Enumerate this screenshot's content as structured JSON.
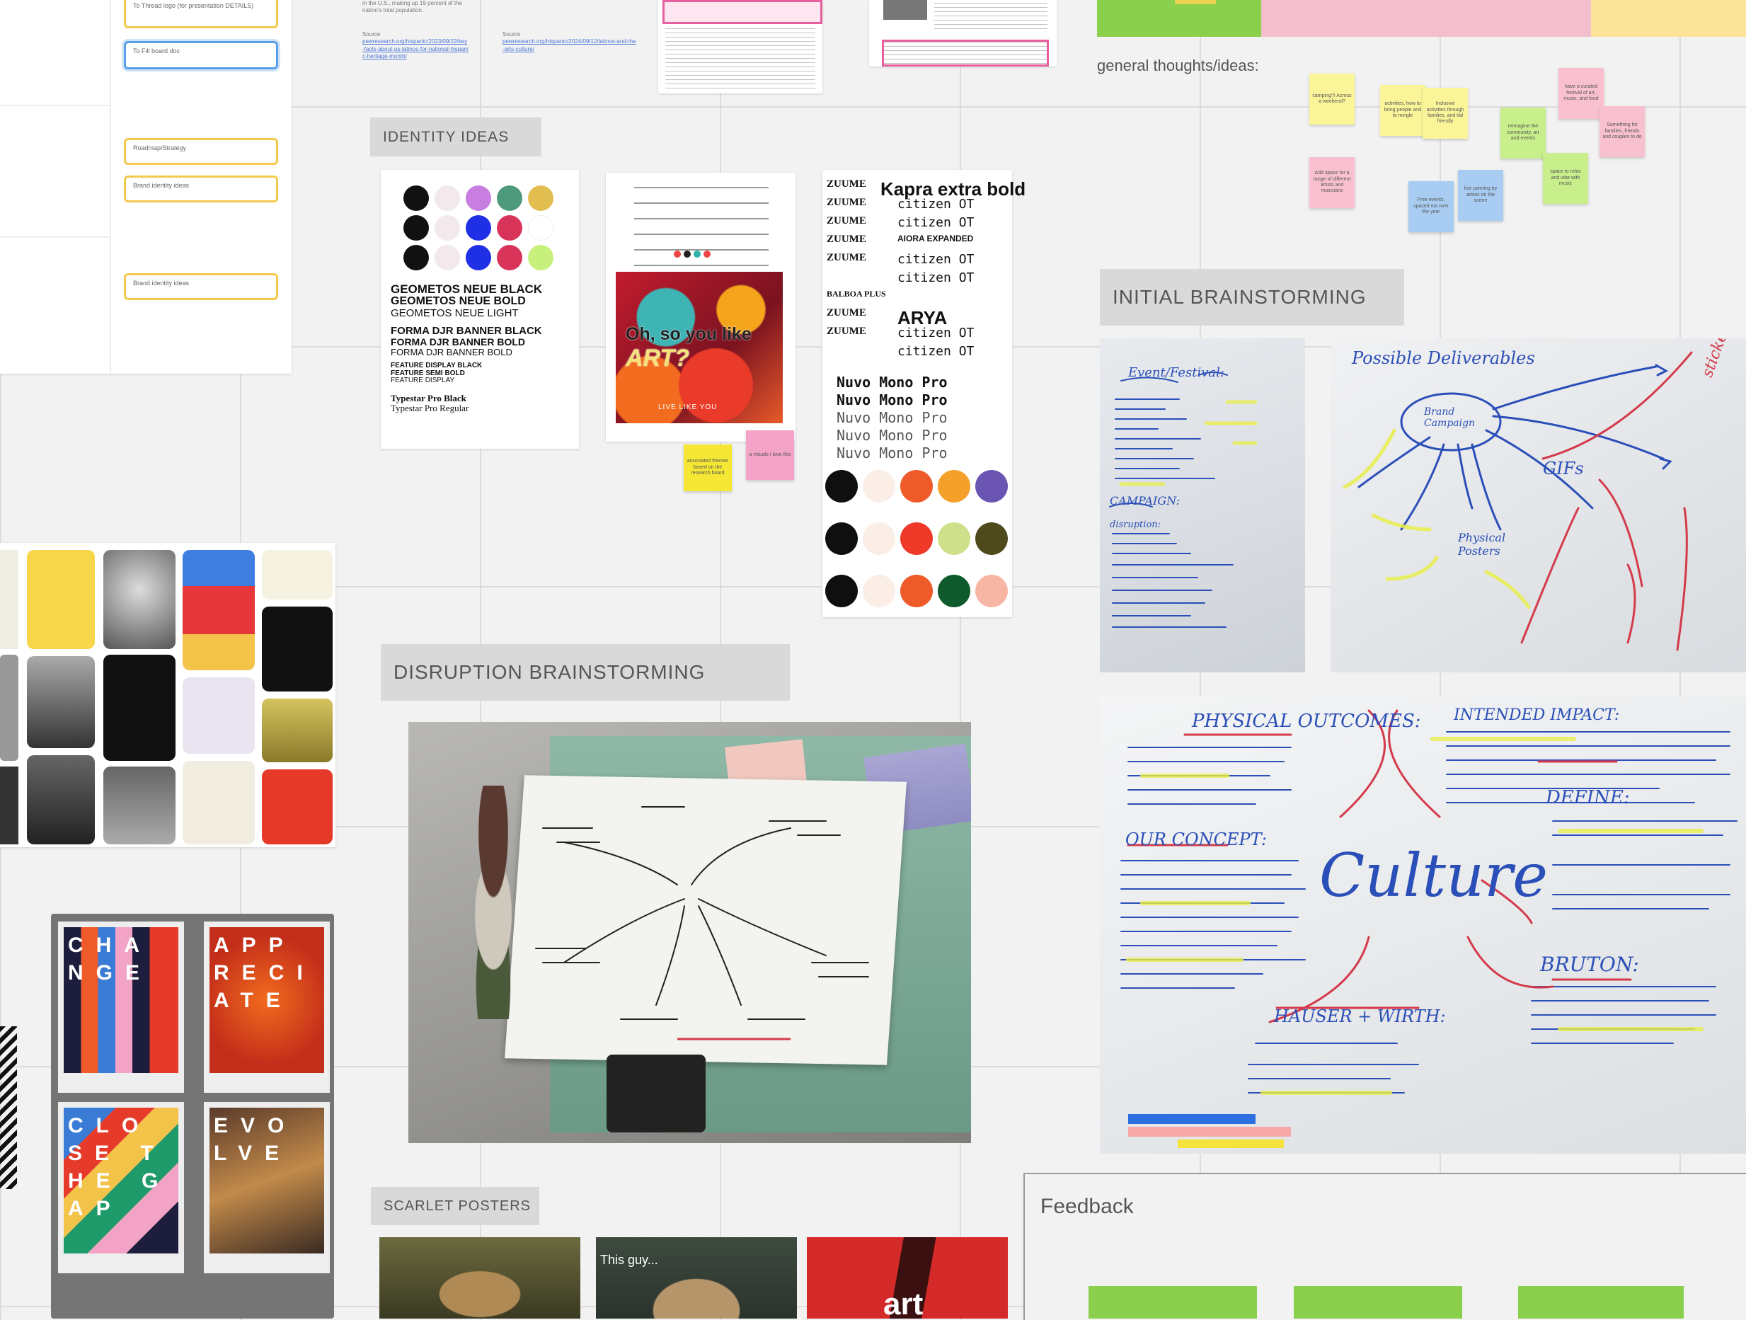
{
  "left_panel": {
    "top_note": "To Thread logo (for presentation DETAILS)",
    "input_active": "To Fill board doc",
    "inputs": [
      "Roadmap/Strategy",
      "Brand identity ideas",
      "Brand identity ideas"
    ]
  },
  "research_text": {
    "line1": "in the U.S., making up 19 percent of the",
    "line2": "nation's total population.",
    "src_label1": "Source",
    "src_label2": "Source",
    "link1": "pewresearch.org/hispanic/2023/09/22/key-facts-about-us-latinos-for-national-hispanic-heritage-month/",
    "link2": "pewresearch.org/hispanic/2024/09/12/latinos-and-the-arts-culture/"
  },
  "headings": {
    "identity_ideas": "IDENTITY IDEAS",
    "initial_brainstorming": "INITIAL BRAINSTORMING",
    "disruption_brainstorming": "DISRUPTION  BRAINSTORMING",
    "scarlet_posters": "SCARLET POSTERS",
    "general_thoughts": "general thoughts/ideas:",
    "feedback": "Feedback"
  },
  "identity_palette_card": {
    "fonts": [
      "GEOMETOS NEUE BLACK",
      "GEOMETOS NEUE BOLD",
      "GEOMETOS NEUE LIGHT",
      "FORMA DJR BANNER BLACK",
      "FORMA DJR BANNER BOLD",
      "FORMA DJR BANNER BOLD",
      "FEATURE DISPLAY BLACK",
      "FEATURE SEMI BOLD",
      "FEATURE DISPLAY",
      "Typestar Pro Black",
      "Typestar Pro Regular"
    ],
    "colors": [
      "#111111",
      "#f3e9ec",
      "#c77ee0",
      "#4f9a7c",
      "#e2bd4f",
      "#111111",
      "#f3e9ec",
      "#1f2fe6",
      "#d8345a",
      "#ffffff",
      "#111111",
      "#f3e9ec",
      "#1f2fe6",
      "#d8345a",
      "#c7f07c"
    ]
  },
  "identity_poster_card": {
    "line1": "Oh, so you like",
    "line2": "ART?",
    "bottom": "LIVE LIKE YOU"
  },
  "identity_stickies": {
    "yellow": "associated themes based on the research board",
    "pink": "a visuals I love this"
  },
  "type_specimen_card": {
    "rows": [
      {
        "left": "ZUUME",
        "right": "Kapra extra bold"
      },
      {
        "left": "ZUUME",
        "right": "citizen OT"
      },
      {
        "left": "ZUUME",
        "right": "citizen OT"
      },
      {
        "left": "ZUUME",
        "right": "AIORA EXPANDED"
      },
      {
        "left": "ZUUME",
        "right": "citizen OT"
      },
      {
        "left": "",
        "right": "citizen OT"
      },
      {
        "left": "BALBOA PLUS",
        "right": ""
      },
      {
        "left": "ZUUME",
        "right": "ARYA"
      },
      {
        "left": "ZUUME",
        "right": "citizen OT"
      },
      {
        "left": "",
        "right": "citizen OT"
      }
    ],
    "mono_rows": [
      "Nuvo Mono Pro",
      "Nuvo Mono Pro",
      "Nuvo Mono Pro",
      "Nuvo Mono Pro",
      "Nuvo Mono Pro"
    ],
    "colors": [
      "#0f0f0f",
      "#fbeee6",
      "#ef5a2a",
      "#f5a02a",
      "#6a55b3",
      "#0f0f0f",
      "#fbeee6",
      "#ef3a2a",
      "#cfe08a",
      "#4f4a1c",
      "#0f0f0f",
      "#fbeee6",
      "#ef5a2a",
      "#0f5a2c",
      "#f7b6a3"
    ]
  },
  "top_right_stickies": [
    {
      "text": "camping?! Across a weekend?",
      "color": "#fbf59a"
    },
    {
      "text": "activities, how to bring people and to mingle",
      "color": "#fbf59a"
    },
    {
      "text": "Inclusive activities through families, and kid friendly",
      "color": "#fbf59a"
    },
    {
      "text": "reimagine the community, art and events",
      "color": "#c8ef8b"
    },
    {
      "text": "have a curated festival of art, music, and food",
      "color": "#f9c1d0"
    },
    {
      "text": "Something for families, friends and couples to do",
      "color": "#f9c1d0"
    },
    {
      "text": "Add space for a range of different artists and musicians",
      "color": "#f9c1d0"
    },
    {
      "text": "Free events, spaced out over the year",
      "color": "#a9cdf2"
    },
    {
      "text": "live painting by artists on the scene",
      "color": "#a9cdf2"
    },
    {
      "text": "space to relax and vibe with music",
      "color": "#c8ef8b"
    }
  ],
  "whiteboards": {
    "small_left": [
      "Event/Festival:",
      "CAMPAIGN:",
      "disruption:"
    ],
    "small_right": [
      "Possible Deliverables",
      "Brand Campaign",
      "Physical Posters",
      "GIFs",
      "stickers"
    ],
    "large": {
      "physical": "PHYSICAL OUTCOMES:",
      "impact": "INTENDED IMPACT:",
      "concept": "OUR CONCEPT:",
      "define": "DEFINE:",
      "culture": "Culture",
      "hauser": "HAUSER + WIRTH:",
      "bruton": "BRUTON:"
    }
  },
  "scarlet_posters_preview": {
    "caption2": "This guy...",
    "caption3": "art"
  },
  "bottom_left_posters": [
    {
      "letters": "CHANGE"
    },
    {
      "letters": "APPRECIATE"
    },
    {
      "letters": "CLOSE THE GAP"
    },
    {
      "letters": "EVOLVE"
    }
  ]
}
